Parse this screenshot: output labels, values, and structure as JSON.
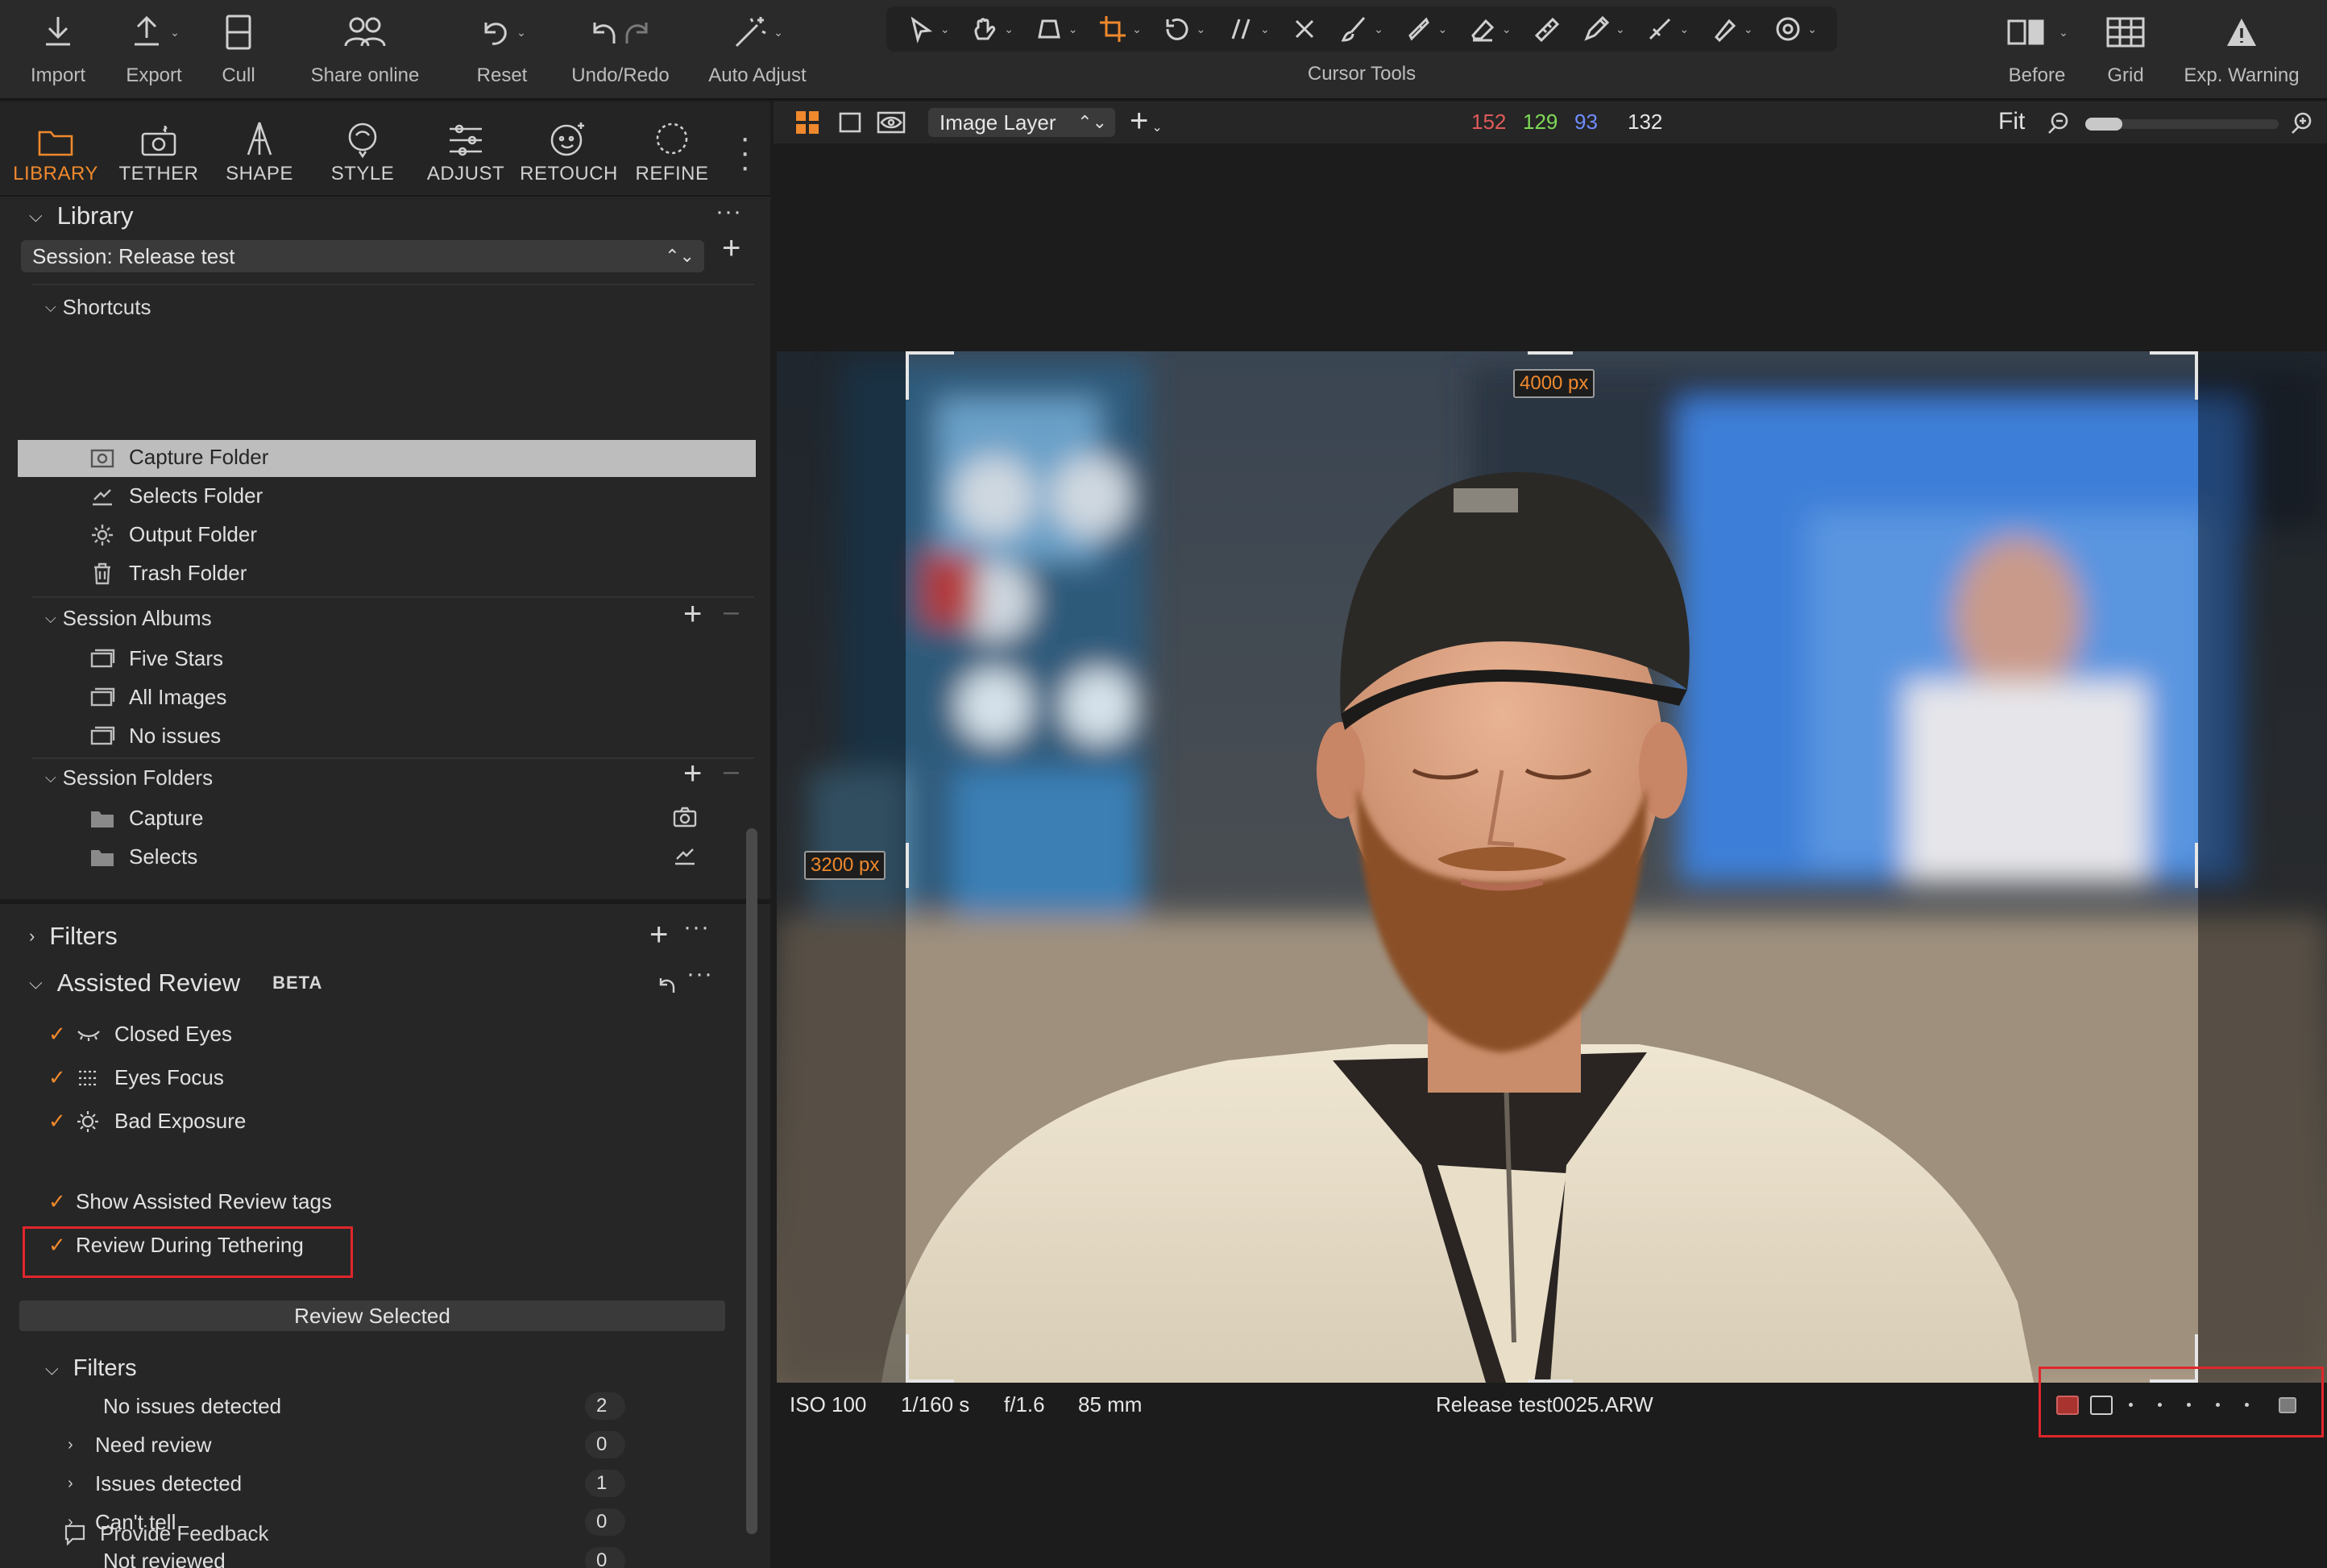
{
  "toolbar": {
    "import": "Import",
    "export": "Export",
    "cull": "Cull",
    "share_online": "Share online",
    "reset": "Reset",
    "undo_redo": "Undo/Redo",
    "auto_adjust": "Auto Adjust",
    "cursor_tools": "Cursor Tools",
    "before": "Before",
    "grid": "Grid",
    "exp_warning": "Exp. Warning"
  },
  "tabs": [
    "LIBRARY",
    "TETHER",
    "SHAPE",
    "STYLE",
    "ADJUST",
    "RETOUCH",
    "REFINE"
  ],
  "active_tab": "LIBRARY",
  "library": {
    "title": "Library",
    "session": "Session: Release test",
    "shortcuts": {
      "title": "Shortcuts",
      "items": [
        "Capture Folder",
        "Selects Folder",
        "Output Folder",
        "Trash Folder"
      ]
    },
    "albums": {
      "title": "Session Albums",
      "items": [
        "Five Stars",
        "All Images",
        "No issues"
      ]
    },
    "folders": {
      "title": "Session Folders",
      "items": [
        "Capture",
        "Selects"
      ]
    }
  },
  "filters_section": "Filters",
  "assisted": {
    "title": "Assisted Review",
    "badge": "BETA",
    "checks": [
      "Closed Eyes",
      "Eyes Focus",
      "Bad Exposure"
    ],
    "show_tags": "Show Assisted Review tags",
    "during_tethering": "Review During Tethering",
    "review_selected": "Review Selected",
    "filters_title": "Filters",
    "filters": [
      {
        "label": "No issues detected",
        "count": "2"
      },
      {
        "label": "Need review",
        "count": "0"
      },
      {
        "label": "Issues detected",
        "count": "1"
      },
      {
        "label": "Can't tell",
        "count": "0"
      },
      {
        "label": "Not reviewed",
        "count": "0"
      }
    ],
    "feedback": "Provide Feedback"
  },
  "viewer": {
    "layer": "Image Layer",
    "r": "152",
    "g": "129",
    "b": "93",
    "l": "132",
    "fit": "Fit",
    "width_tag": "4000 px",
    "height_tag": "3200 px",
    "iso": "ISO 100",
    "shutter": "1/160 s",
    "aperture": "f/1.6",
    "focal": "85 mm",
    "filename": "Release test0025.ARW"
  },
  "colors": {
    "accent": "#f0892d",
    "highlight_box": "#e0262b",
    "red": "#e05a5a",
    "green": "#7ed957",
    "blue": "#6f8cff"
  }
}
